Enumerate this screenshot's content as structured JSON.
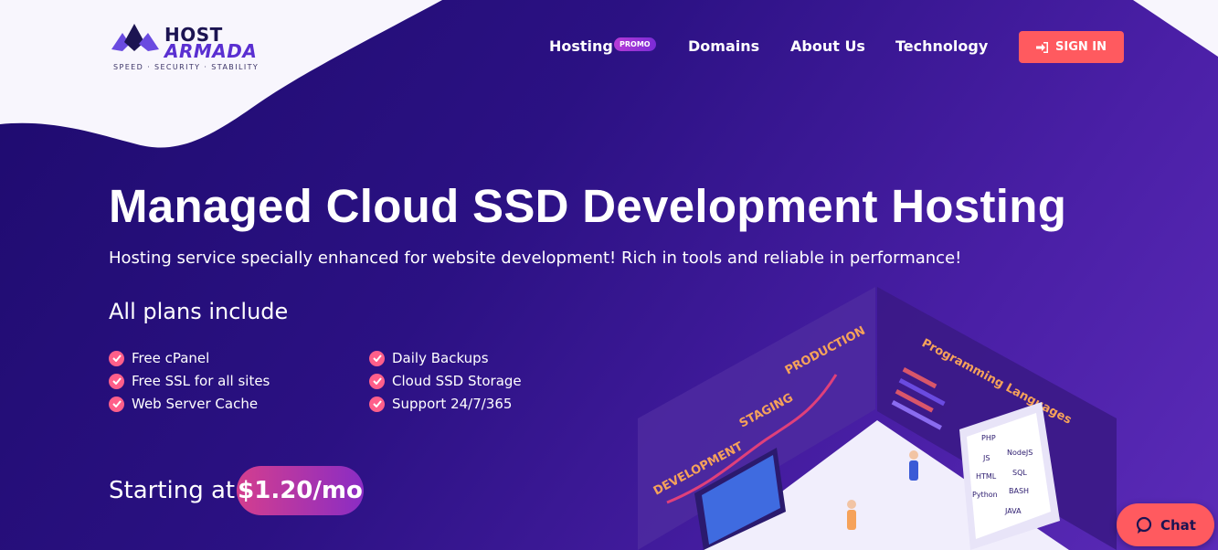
{
  "logo": {
    "line1": "HOST",
    "line2": "ARMADA",
    "tagline": "SPEED · SECURITY · STABILITY"
  },
  "nav": {
    "items": [
      {
        "label": "Hosting",
        "badge": "PROMO"
      },
      {
        "label": "Domains"
      },
      {
        "label": "About Us"
      },
      {
        "label": "Technology"
      }
    ],
    "signin": {
      "label": "SIGN IN",
      "icon": "sign-in-icon"
    }
  },
  "hero": {
    "title": "Managed Cloud SSD Development Hosting",
    "subtitle": "Hosting service specially enhanced for website development! Rich in tools and reliable in performance!",
    "plans_heading": "All plans include",
    "features_left": [
      "Free cPanel",
      "Free SSL for all sites",
      "Web Server Cache"
    ],
    "features_right": [
      "Daily Backups",
      "Cloud SSD Storage",
      "Support 24/7/365"
    ],
    "starting_label": "Starting at",
    "price": "$1.20/mo"
  },
  "illustration": {
    "labels": {
      "development": "DEVELOPMENT",
      "staging": "STAGING",
      "production": "PRODUCTION",
      "languages_title": "Programming Languages"
    },
    "languages_left": [
      "PHP",
      "JS",
      "HTML",
      "Python"
    ],
    "languages_right": [
      "NodeJS",
      "SQL",
      "BASH",
      "JAVA"
    ]
  },
  "chat": {
    "label": "Chat",
    "icon": "chat-bubble-icon"
  },
  "colors": {
    "accent": "#ff5a5f",
    "background": "#2a0f79",
    "check": "#ff5f8a",
    "label_orange": "#f6a25a"
  }
}
